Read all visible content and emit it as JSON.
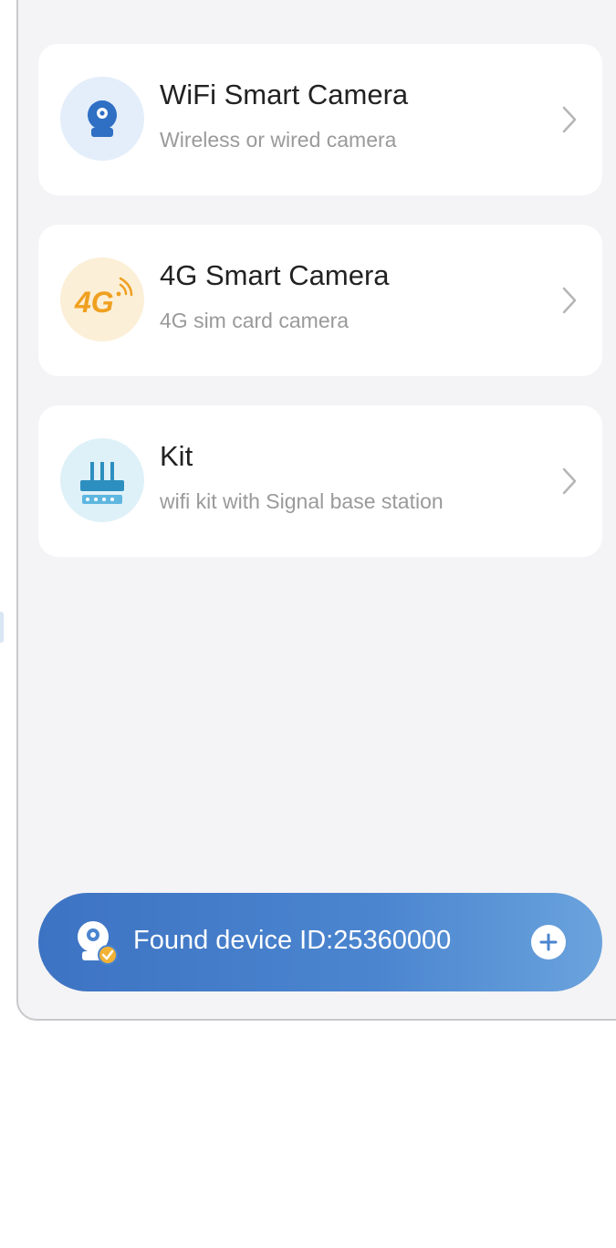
{
  "device_types": [
    {
      "id": "wifi",
      "title": "WiFi Smart Camera",
      "subtitle": "Wireless or wired camera",
      "icon": "camera-icon",
      "icon_bg": "#e3eefa",
      "icon_color": "#2f6fc4"
    },
    {
      "id": "4g",
      "title": "4G Smart Camera",
      "subtitle": "4G sim card camera",
      "icon": "4g-signal-icon",
      "icon_bg": "#fcefd7",
      "icon_color": "#f0a020",
      "icon_text": "4G"
    },
    {
      "id": "kit",
      "title": "Kit",
      "subtitle": "wifi kit with Signal base station",
      "icon": "router-icon",
      "icon_bg": "#dff1f8",
      "icon_color": "#2d8fbf"
    }
  ],
  "found_device": {
    "text": "Found device ID:25360000",
    "icon": "found-camera-icon",
    "action_icon": "plus-icon",
    "bg_color": "#4b85cf"
  },
  "colors": {
    "page_bg": "#f4f3f5",
    "card_bg": "#ffffff",
    "chevron": "#b5b5b5"
  }
}
